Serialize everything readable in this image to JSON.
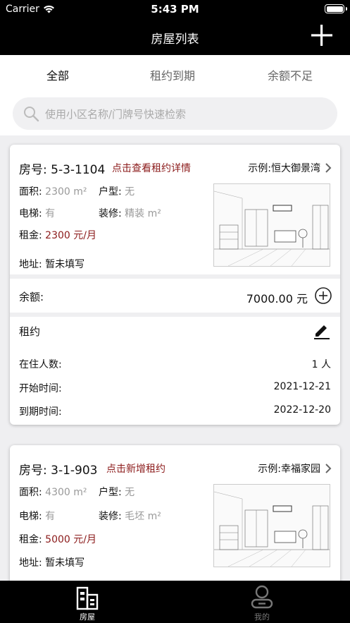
{
  "status_bar": {
    "carrier": "Carrier",
    "time": "5:43 PM"
  },
  "nav": {
    "title": "房屋列表",
    "add_icon": "plus-icon"
  },
  "tabs": [
    {
      "label": "全部",
      "active": true
    },
    {
      "label": "租约到期",
      "active": false
    },
    {
      "label": "余额不足",
      "active": false
    }
  ],
  "search": {
    "placeholder": "使用小区名称/门牌号快速检索"
  },
  "houses": [
    {
      "house_no": "房号: 5-3-1104",
      "action_link": "点击查看租约详情",
      "community": "示例:恒大御景湾",
      "area_label": "面积:",
      "area_value": "2300 m²",
      "layout_label": "户型:",
      "layout_value": "无",
      "elevator_label": "电梯:",
      "elevator_value": "有",
      "decoration_label": "装修:",
      "decoration_value": "精装 m²",
      "rent_label": "租金:",
      "rent_value": "2300 元/月",
      "address_label": "地址:",
      "address_value": "暂未填写",
      "balance_label": "余额:",
      "balance_value": "7000.00 元",
      "lease": {
        "title": "租约",
        "occupants_label": "在住人数:",
        "occupants_value": "1 人",
        "start_label": "开始时间:",
        "start_value": "2021-12-21",
        "end_label": "到期时间:",
        "end_value": "2022-12-20"
      }
    },
    {
      "house_no": "房号: 3-1-903",
      "action_link": "点击新增租约",
      "community": "示例:幸福家园",
      "area_label": "面积:",
      "area_value": "4300 m²",
      "layout_label": "户型:",
      "layout_value": "无",
      "elevator_label": "电梯:",
      "elevator_value": "有",
      "decoration_label": "装修:",
      "decoration_value": "毛坯 m²",
      "rent_label": "租金:",
      "rent_value": "5000 元/月",
      "address_label": "地址:",
      "address_value": "暂未填写"
    }
  ],
  "bottom_tabs": [
    {
      "label": "房屋",
      "active": true
    },
    {
      "label": "我的",
      "active": false
    }
  ],
  "colors": {
    "accent": "#8b1a1a",
    "nav_bg": "#000000",
    "muted": "#999999"
  }
}
